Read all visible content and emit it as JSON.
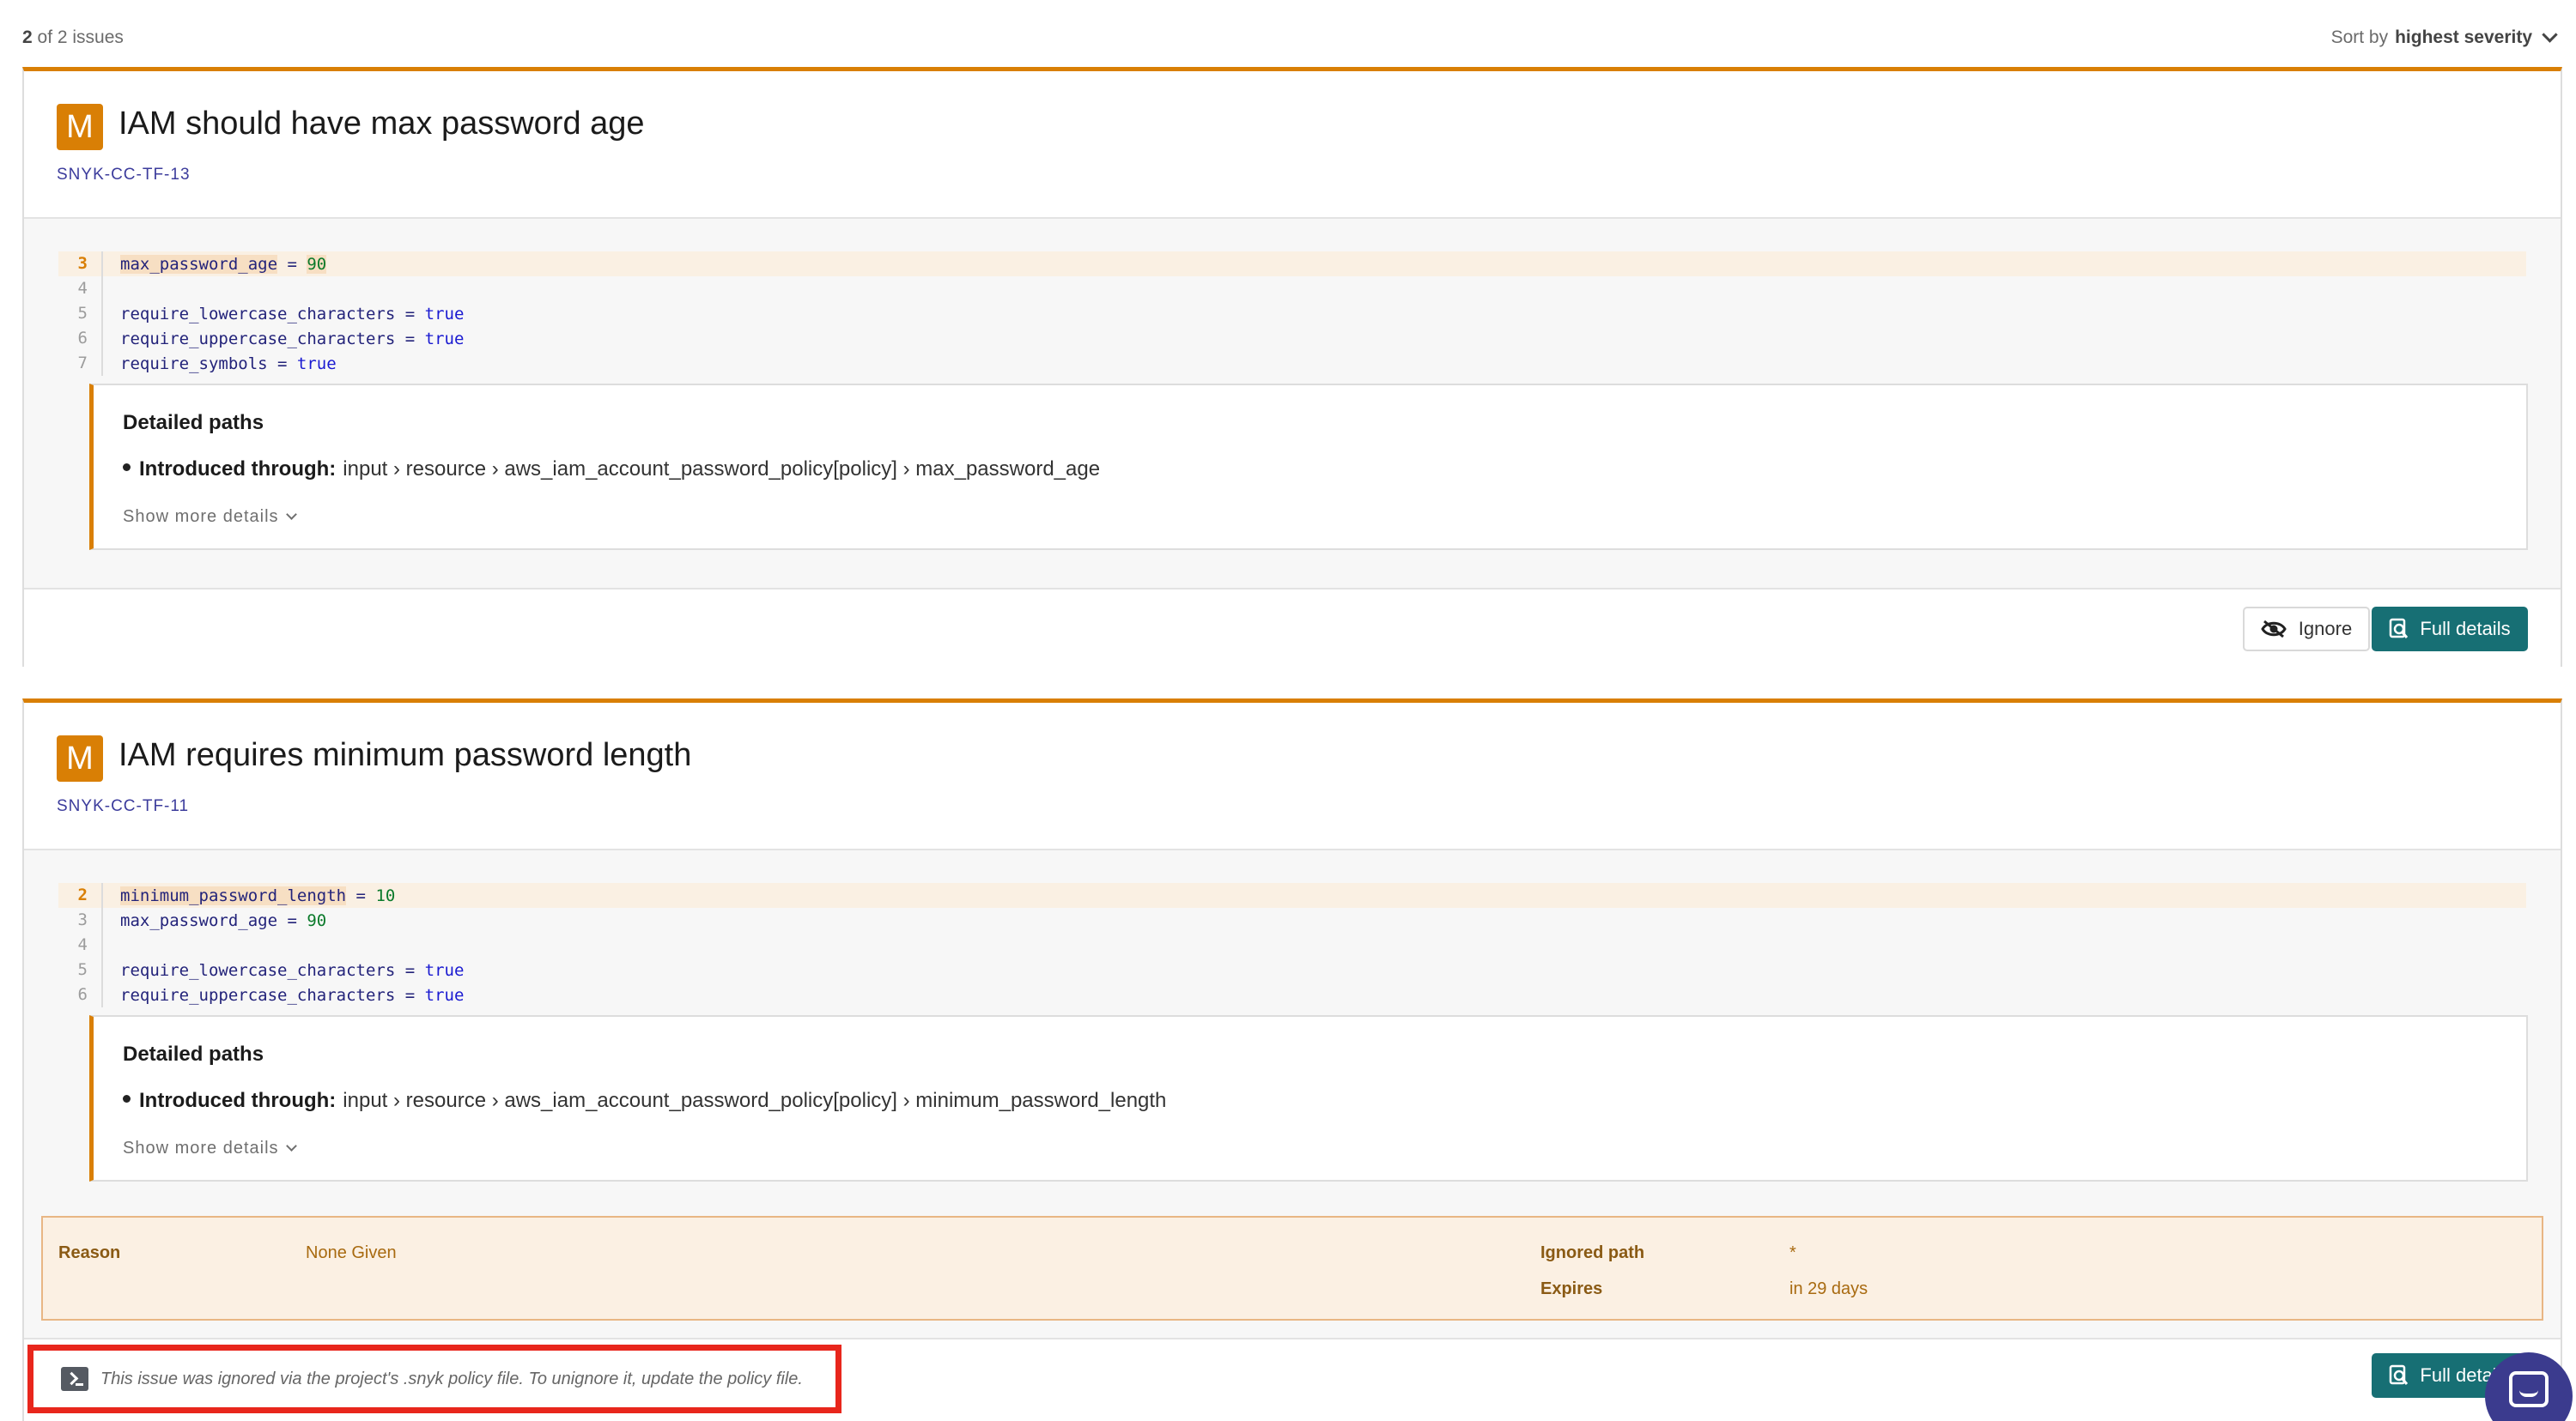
{
  "header": {
    "count_shown": "2",
    "count_rest": "of 2 issues",
    "sort_prefix": "Sort by",
    "sort_value": "highest severity"
  },
  "issues": [
    {
      "severity": "M",
      "title": "IAM should have max password age",
      "rule_id": "SNYK-CC-TF-13",
      "code": [
        {
          "line": "3",
          "key": "max_password_age",
          "op": " = ",
          "value": "90",
          "value_type": "num",
          "highlight": true
        },
        {
          "line": "4",
          "key": "",
          "op": "",
          "value": "",
          "value_type": "",
          "highlight": false
        },
        {
          "line": "5",
          "key": "require_lowercase_characters",
          "op": " = ",
          "value": "true",
          "value_type": "kw",
          "highlight": false
        },
        {
          "line": "6",
          "key": "require_uppercase_characters",
          "op": " = ",
          "value": "true",
          "value_type": "kw",
          "highlight": false
        },
        {
          "line": "7",
          "key": "require_symbols",
          "op": " = ",
          "value": "true",
          "value_type": "kw",
          "highlight": false
        }
      ],
      "paths_title": "Detailed paths",
      "introduced_label": "Introduced through:",
      "introduced_path": "input › resource › aws_iam_account_password_policy[policy] › max_password_age",
      "show_more": "Show more details",
      "ignore_label": "Ignore",
      "full_details_label": "Full details"
    },
    {
      "severity": "M",
      "title": "IAM requires minimum password length",
      "rule_id": "SNYK-CC-TF-11",
      "code": [
        {
          "line": "2",
          "key": "minimum_password_length",
          "op": " = ",
          "value": "10",
          "value_type": "num",
          "highlight": true
        },
        {
          "line": "3",
          "key": "max_password_age",
          "op": " = ",
          "value": "90",
          "value_type": "num",
          "highlight": false
        },
        {
          "line": "4",
          "key": "",
          "op": "",
          "value": "",
          "value_type": "",
          "highlight": false
        },
        {
          "line": "5",
          "key": "require_lowercase_characters",
          "op": " = ",
          "value": "true",
          "value_type": "kw",
          "highlight": false
        },
        {
          "line": "6",
          "key": "require_uppercase_characters",
          "op": " = ",
          "value": "true",
          "value_type": "kw",
          "highlight": false
        }
      ],
      "paths_title": "Detailed paths",
      "introduced_label": "Introduced through:",
      "introduced_path": "input › resource › aws_iam_account_password_policy[policy] › minimum_password_length",
      "show_more": "Show more details",
      "ignore_info": {
        "reason_label": "Reason",
        "reason_value": "None Given",
        "ignored_path_label": "Ignored path",
        "ignored_path_value": "*",
        "expires_label": "Expires",
        "expires_value": "in 29 days"
      },
      "ignored_notice": "This issue was ignored via the project's .snyk policy file. To unignore it, update the policy file.",
      "full_details_label": "Full details"
    }
  ],
  "colors": {
    "severity_medium": "#d97f05",
    "primary_button": "#176f74",
    "highlight_box": "#e8261c",
    "chat_button": "#3b3b8e"
  },
  "icons": {
    "sort": "chevron-down-icon",
    "ignore": "eye-off-icon",
    "full_details": "search-document-icon",
    "notice": "terminal-icon",
    "chat": "chat-icon"
  }
}
